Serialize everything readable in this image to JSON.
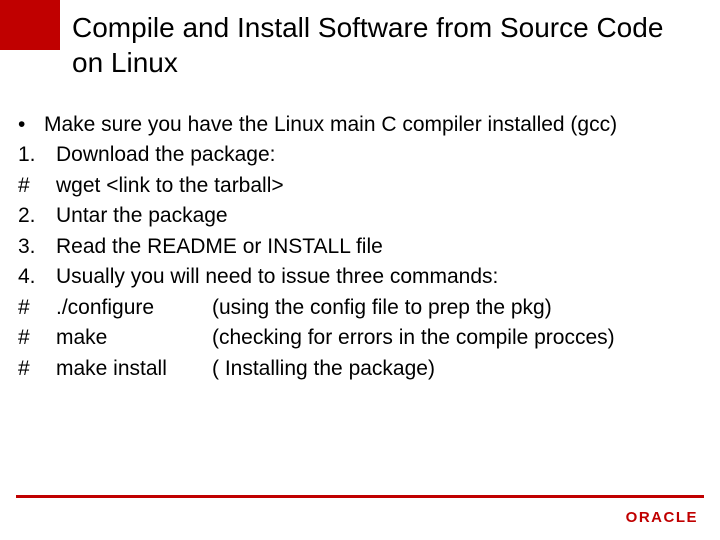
{
  "title": "Compile and Install Software from Source Code on Linux",
  "bullet": {
    "marker": "•",
    "text": "Make sure you have the Linux main C compiler installed (gcc)"
  },
  "lines": [
    {
      "marker": "1.",
      "text": "Download the package:"
    },
    {
      "marker": "#",
      "text": "wget <link to the tarball>"
    },
    {
      "marker": "2.",
      "text": "Untar the package"
    },
    {
      "marker": "3.",
      "text": "Read the README or INSTALL file"
    },
    {
      "marker": "4.",
      "text": "Usually you will need to issue three commands:"
    }
  ],
  "cmds": [
    {
      "marker": "#",
      "cmd": "./configure",
      "note": "(using the config file to prep the pkg)"
    },
    {
      "marker": "#",
      "cmd": "make",
      "note": "(checking for errors in the compile procces)"
    },
    {
      "marker": "#",
      "cmd": "make install",
      "note": "( Installing the package)"
    }
  ],
  "logo": "ORACLE"
}
